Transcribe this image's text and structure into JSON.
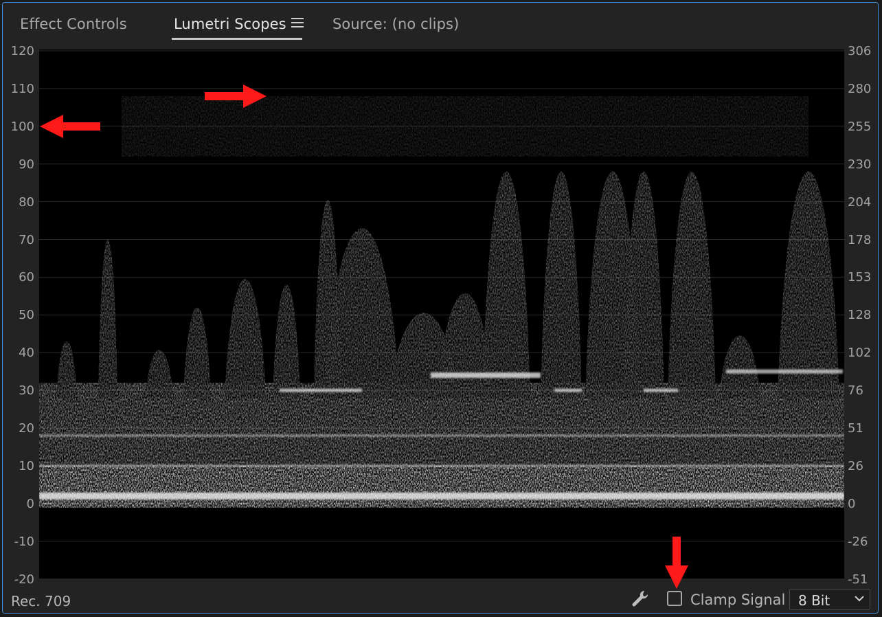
{
  "tabs": [
    {
      "label": "Effect Controls",
      "active": false
    },
    {
      "label": "Lumetri Scopes",
      "active": true
    },
    {
      "label": "Source: (no clips)",
      "active": false
    }
  ],
  "scope": {
    "type": "luma-waveform",
    "left_axis_ticks": [
      "120",
      "110",
      "100",
      "90",
      "80",
      "70",
      "60",
      "50",
      "40",
      "30",
      "20",
      "10",
      "0",
      "-10",
      "-20"
    ],
    "right_axis_ticks": [
      "306",
      "280",
      "255",
      "230",
      "204",
      "178",
      "153",
      "128",
      "102",
      "76",
      "51",
      "26",
      "0",
      "-26",
      "-51"
    ]
  },
  "footer": {
    "color_space": "Rec. 709",
    "clamp_label": "Clamp Signal",
    "clamp_checked": false,
    "bit_depth": "8 Bit"
  },
  "annotations": {
    "arrow_color": "#ff0000"
  },
  "colors": {
    "panel_border": "#3f8fe0",
    "scope_background": "#000000",
    "trace": "#e0e0e0"
  }
}
